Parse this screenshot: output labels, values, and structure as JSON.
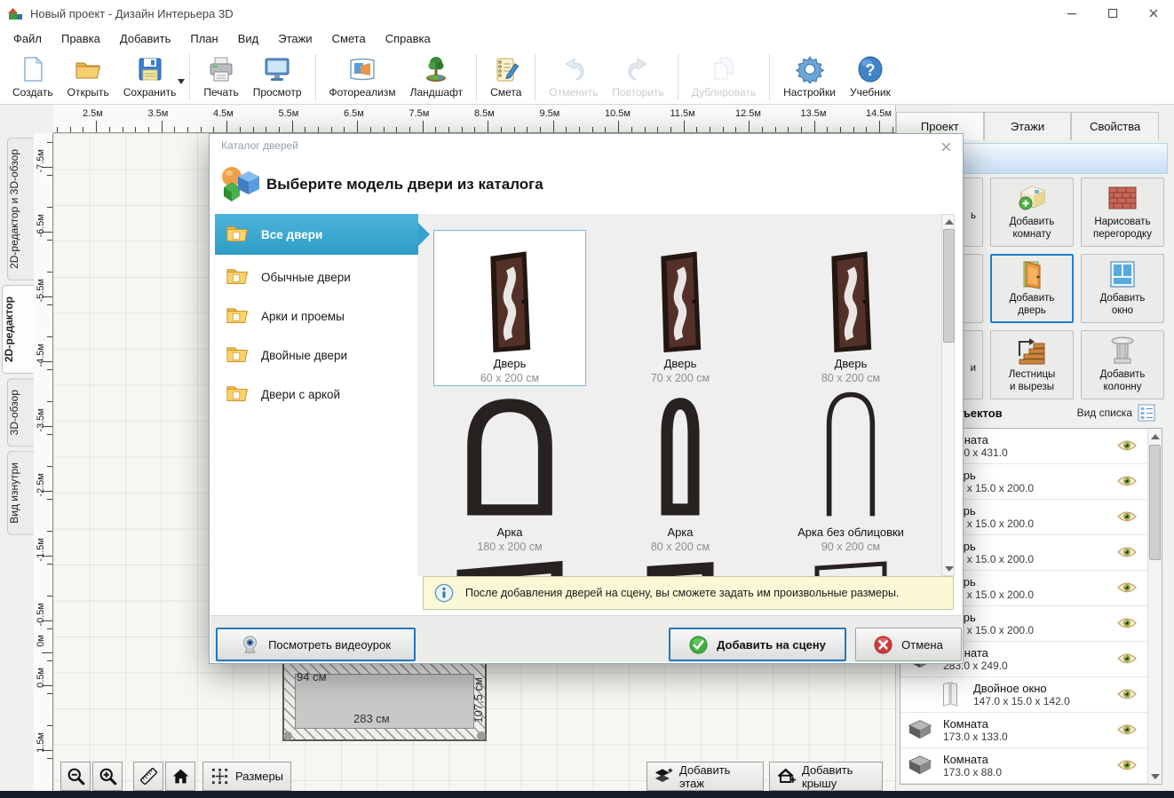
{
  "window": {
    "title": "Новый проект - Дизайн Интерьера 3D"
  },
  "menu": [
    {
      "label": "Файл"
    },
    {
      "label": "Правка"
    },
    {
      "label": "Добавить"
    },
    {
      "label": "План"
    },
    {
      "label": "Вид"
    },
    {
      "label": "Этажи"
    },
    {
      "label": "Смета"
    },
    {
      "label": "Справка"
    }
  ],
  "toolbar_groups": [
    {
      "buttons": [
        {
          "label": "Создать",
          "icon": "new-file-icon"
        },
        {
          "label": "Открыть",
          "icon": "open-folder-icon"
        },
        {
          "label": "Сохранить",
          "icon": "save-icon",
          "dropdown": true
        }
      ]
    },
    {
      "buttons": [
        {
          "label": "Печать",
          "icon": "print-icon"
        },
        {
          "label": "Просмотр",
          "icon": "preview-icon"
        }
      ]
    },
    {
      "buttons": [
        {
          "label": "Фотореализм",
          "icon": "photorealism-icon"
        },
        {
          "label": "Ландшафт",
          "icon": "landscape-icon"
        }
      ]
    },
    {
      "buttons": [
        {
          "label": "Смета",
          "icon": "estimate-icon"
        }
      ]
    },
    {
      "buttons": [
        {
          "label": "Отменить",
          "icon": "undo-icon",
          "disabled": true
        },
        {
          "label": "Повторить",
          "icon": "redo-icon",
          "disabled": true
        }
      ]
    },
    {
      "buttons": [
        {
          "label": "Дублировать",
          "icon": "duplicate-icon",
          "disabled": true
        }
      ]
    },
    {
      "buttons": [
        {
          "label": "Настройки",
          "icon": "settings-icon"
        },
        {
          "label": "Учебник",
          "icon": "tutorial-icon"
        }
      ]
    }
  ],
  "rulers": {
    "horizontal": [
      {
        "label": "2.5м",
        "m": 2.5
      },
      {
        "label": "3.5м",
        "m": 3.5
      },
      {
        "label": "4.5м",
        "m": 4.5
      },
      {
        "label": "5.5м",
        "m": 5.5
      },
      {
        "label": "6.5м",
        "m": 6.5
      },
      {
        "label": "7.5м",
        "m": 7.5
      },
      {
        "label": "8.5м",
        "m": 8.5
      },
      {
        "label": "9.5м",
        "m": 9.5
      },
      {
        "label": "10.5м",
        "m": 10.5
      },
      {
        "label": "11.5м",
        "m": 11.5
      },
      {
        "label": "12.5м",
        "m": 12.5
      },
      {
        "label": "13.5м",
        "m": 13.5
      },
      {
        "label": "14.5м",
        "m": 14.5
      }
    ],
    "vertical": [
      {
        "label": "-7.5м",
        "m": -7.5
      },
      {
        "label": "-6.5м",
        "m": -6.5
      },
      {
        "label": "-5.5м",
        "m": -5.5
      },
      {
        "label": "-4.5м",
        "m": -4.5
      },
      {
        "label": "-3.5м",
        "m": -3.5
      },
      {
        "label": "-2.5м",
        "m": -2.5
      },
      {
        "label": "-1.5м",
        "m": -1.5
      },
      {
        "label": "-0.5м",
        "m": -0.5
      },
      {
        "label": "0м",
        "m": 0
      },
      {
        "label": "0.5м",
        "m": 0.5
      },
      {
        "label": "1.5м",
        "m": 1.5
      }
    ]
  },
  "left_tabs": [
    {
      "label": "2D-редактор и 3D-обзор"
    },
    {
      "label": "2D-редактор",
      "selected": true
    },
    {
      "label": "3D-обзор"
    },
    {
      "label": "Вид изнутри"
    }
  ],
  "canvas": {
    "room": {
      "top_label": "94 см",
      "bottom_label": "283 см",
      "right_label": "107,5 см"
    }
  },
  "bottom_bar": {
    "sizes": "Размеры",
    "add_floor": "Добавить этаж",
    "add_roof": "Добавить крышу"
  },
  "dialog": {
    "title": "Каталог дверей",
    "heading": "Выберите модель двери из каталога",
    "categories": [
      {
        "label": "Все двери",
        "icon": "folder-icon",
        "selected": true
      },
      {
        "label": "Обычные двери",
        "icon": "folder-icon"
      },
      {
        "label": "Арки и проемы",
        "icon": "folder-icon"
      },
      {
        "label": "Двойные двери",
        "icon": "folder-icon"
      },
      {
        "label": "Двери с аркой",
        "icon": "folder-icon"
      }
    ],
    "items": [
      {
        "name": "Дверь",
        "size": "60 x 200 см",
        "thumb": "door-thumb",
        "selected": true
      },
      {
        "name": "Дверь",
        "size": "70 x 200 см",
        "thumb": "door-thumb"
      },
      {
        "name": "Дверь",
        "size": "80 x 200 см",
        "thumb": "door-thumb"
      },
      {
        "name": "Арка",
        "size": "180 x 200 см",
        "thumb": "arch-wide-thumb"
      },
      {
        "name": "Арка",
        "size": "80 x 200 см",
        "thumb": "arch-narrow-thumb"
      },
      {
        "name": "Арка без облицовки",
        "size": "90 x 200 см",
        "thumb": "arch-open-thumb"
      },
      {
        "name": "",
        "size": "",
        "thumb": "partial-wide-thumb",
        "mods": [
          "partial"
        ]
      },
      {
        "name": "",
        "size": "",
        "thumb": "partial-narrow-thumb",
        "mods": [
          "partial"
        ]
      },
      {
        "name": "",
        "size": "",
        "thumb": "partial-open-thumb",
        "mods": [
          "partial"
        ]
      }
    ],
    "info": "После добавления дверей на сцену, вы сможете задать им произвольные размеры.",
    "video_button": "Посмотреть видеоурок",
    "add_button": "Добавить на сцену",
    "cancel_button": "Отмена"
  },
  "right_panel": {
    "tabs": [
      {
        "label": "Проект",
        "selected": true
      },
      {
        "label": "Этажи"
      },
      {
        "label": "Свойства"
      }
    ],
    "tools": [
      {
        "label": "ь",
        "icon": "",
        "mods": [
          "covered"
        ]
      },
      {
        "label": "Добавить\nкомнату",
        "icon": "add-room-icon"
      },
      {
        "label": "Нарисовать\nперегородку",
        "icon": "draw-partition-icon"
      },
      {
        "label": "",
        "icon": "",
        "mods": [
          "covered"
        ]
      },
      {
        "label": "Добавить\nдверь",
        "icon": "add-door-icon",
        "selected": true
      },
      {
        "label": "Добавить\nокно",
        "icon": "add-window-icon"
      },
      {
        "label": "и",
        "icon": "",
        "mods": [
          "covered"
        ]
      },
      {
        "label": "Лестницы\nи вырезы",
        "icon": "stairs-icon"
      },
      {
        "label": "Добавить\nколонну",
        "icon": "add-column-icon"
      }
    ],
    "objects_header": {
      "title": "Список объектов",
      "view_label": "Вид списка"
    },
    "objects": [
      {
        "name": "Комната",
        "dims": "283.0 x 431.0",
        "icon": "room-obj-icon"
      },
      {
        "name": "Дверь",
        "dims": "90.0 x 15.0 x 200.0",
        "icon": "door-obj-icon"
      },
      {
        "name": "Дверь",
        "dims": "90.0 x 15.0 x 200.0",
        "icon": "door-obj-icon"
      },
      {
        "name": "Дверь",
        "dims": "90.0 x 15.0 x 200.0",
        "icon": "door-obj-icon"
      },
      {
        "name": "Дверь",
        "dims": "90.0 x 15.0 x 200.0",
        "icon": "door-obj-icon"
      },
      {
        "name": "Дверь",
        "dims": "90.0 x 15.0 x 200.0",
        "icon": "door-obj-icon"
      },
      {
        "name": "Комната",
        "dims": "283.0 x 249.0",
        "icon": "room-obj-icon"
      },
      {
        "name": "Двойное окно",
        "dims": "147.0 x 15.0 x 142.0",
        "icon": "window-obj-icon",
        "mods": [
          "indent"
        ]
      },
      {
        "name": "Комната",
        "dims": "173.0 x 133.0",
        "icon": "room-obj-icon"
      },
      {
        "name": "Комната",
        "dims": "173.0 x 88.0",
        "icon": "room-obj-icon"
      }
    ]
  },
  "colors": {
    "accent_blue": "#2277bd",
    "category_selected": "#35a2cb",
    "selected_cell_border": "#74bcd8",
    "info_bg": "#fbf8d5"
  }
}
